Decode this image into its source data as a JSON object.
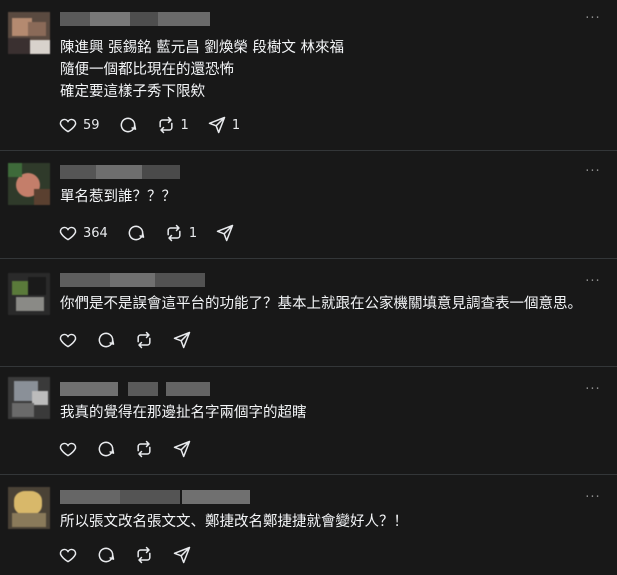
{
  "more_glyph": "···",
  "posts": [
    {
      "lines": [
        "陳進興 張錫銘 藍元昌 劉煥榮 段樹文 林來福",
        "隨便一個都比現在的還恐怖",
        "確定要這樣子秀下限欸"
      ],
      "likes": "59",
      "reposts": "1",
      "shares": "1"
    },
    {
      "lines": [
        "單名惹到誰？？？"
      ],
      "likes": "364",
      "reposts": "1",
      "shares": ""
    },
    {
      "lines": [
        "你們是不是誤會這平台的功能了？基本上就跟在公家機關填意見調查表一個意思。"
      ],
      "likes": "",
      "reposts": "",
      "shares": ""
    },
    {
      "lines": [
        "我真的覺得在那邊扯名字兩個字的超瞎"
      ],
      "likes": "",
      "reposts": "",
      "shares": ""
    },
    {
      "lines": [
        "所以張文改名張文文、鄭捷改名鄭捷捷就會變好人？！"
      ],
      "likes": "",
      "reposts": "",
      "shares": ""
    }
  ],
  "icons": {
    "like": "heart-icon",
    "reply": "comment-icon",
    "repost": "repost-icon",
    "share": "share-icon",
    "more": "more-options-icon"
  }
}
